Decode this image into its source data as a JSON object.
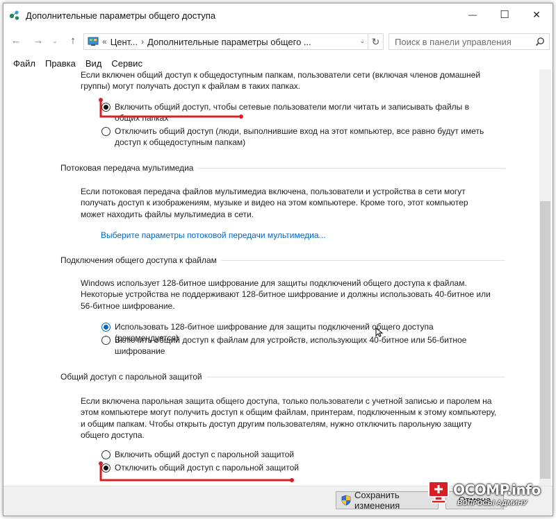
{
  "window": {
    "title": "Дополнительные параметры общего доступа",
    "minimize": "—",
    "maximize": "☐",
    "close": "✕"
  },
  "address_bar": {
    "back": "←",
    "forward": "→",
    "history": "⌄",
    "up": "↑",
    "overflow": "«",
    "crumb_1": "Цент...",
    "separator": "›",
    "crumb_2": "Дополнительные параметры общего ...",
    "dropdown": "⌄",
    "refresh": "↻",
    "search_placeholder": "Поиск в панели управления"
  },
  "menu": [
    "Файл",
    "Правка",
    "Вид",
    "Сервис"
  ],
  "public_folders": {
    "intro_line1": "Если включен общий доступ к общедоступным папкам, пользователи сети (включая членов домашней",
    "intro_line2": "группы) могут получать доступ к файлам в таких папках.",
    "option_on": "Включить общий доступ, чтобы сетевые пользователи могли читать и записывать файлы в общих папках",
    "option_off": "Отключить общий доступ (люди, выполнившие вход на этот компьютер, все равно будут иметь доступ к общедоступным папкам)"
  },
  "media": {
    "heading": "Потоковая передача мультимедиа",
    "description": "Если потоковая передача файлов мультимедиа включена, пользователи и устройства в сети могут получать доступ к изображениям, музыке и видео на этом компьютере. Кроме того, этот компьютер может находить файлы мультимедиа в сети.",
    "link": "Выберите параметры потоковой передачи мультимедиа..."
  },
  "file_sharing": {
    "heading": "Подключения общего доступа к файлам",
    "description": "Windows использует 128-битное шифрование для защиты подключений общего доступа к файлам. Некоторые устройства не поддерживают 128-битное шифрование и должны использовать 40-битное или 56-битное шифрование.",
    "option_128": "Использовать 128-битное шифрование для защиты подключений общего доступа (рекомендуется)",
    "option_40_56": "Включить общий доступ к файлам для устройств, использующих 40-битное или 56-битное шифрование"
  },
  "password": {
    "heading": "Общий доступ с парольной защитой",
    "description": "Если включена парольная защита общего доступа, только пользователи с учетной записью и паролем на этом компьютере могут получить доступ к общим файлам, принтерам, подключенным к этому компьютеру, и общим папкам. Чтобы открыть доступ другим пользователям, нужно отключить парольную защиту общего доступа.",
    "option_on": "Включить общий доступ с парольной защитой",
    "option_off": "Отключить общий доступ с парольной защитой"
  },
  "footer": {
    "save": "Сохранить изменения",
    "cancel": "Отмена"
  },
  "watermark": {
    "brand": "OCOMP.info",
    "tagline": "ВОПРОСЫ АДМИНУ"
  },
  "colors": {
    "accent": "#0067c0",
    "link": "#0066cc",
    "annotation": "#d81f26"
  }
}
